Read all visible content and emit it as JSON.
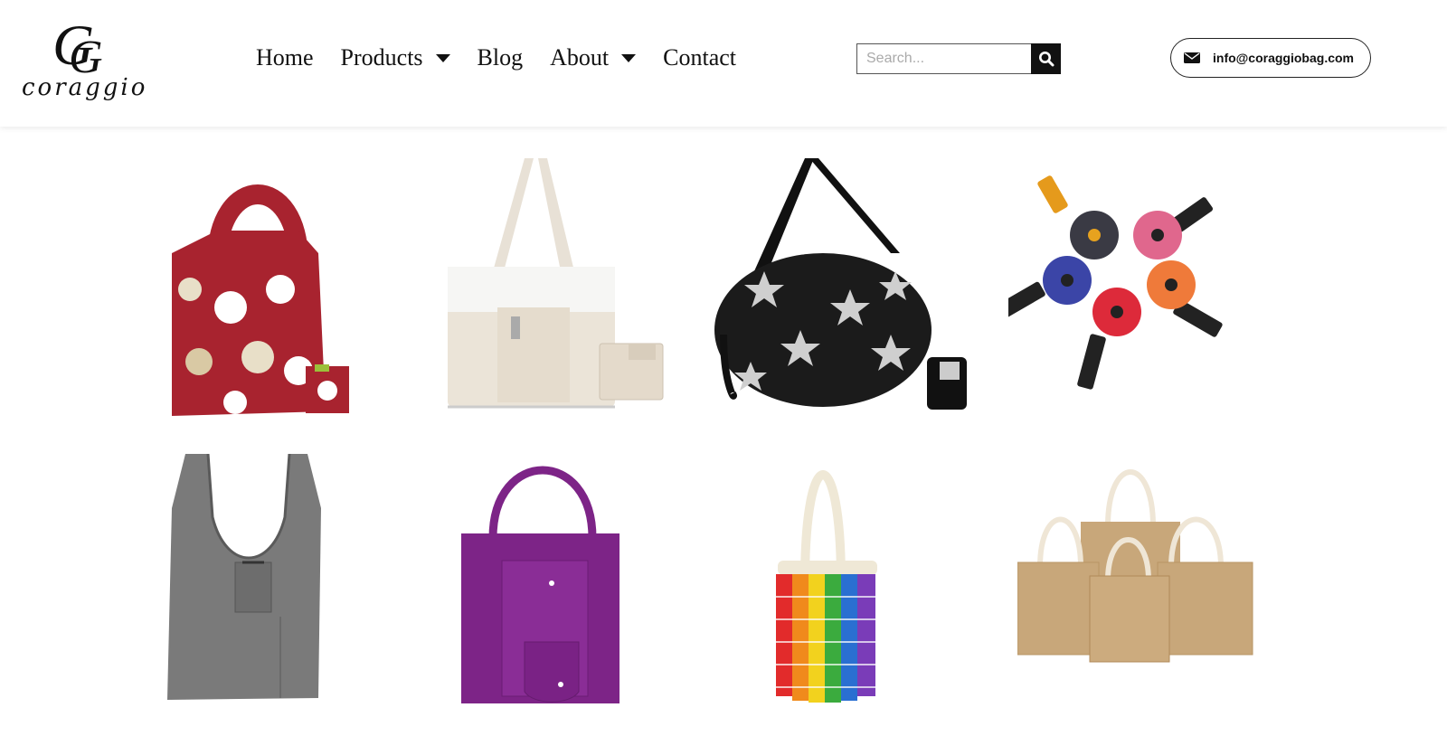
{
  "brand": {
    "logo_letters": "G",
    "logo_word": "coraggio"
  },
  "nav": {
    "items": [
      {
        "label": "Home",
        "has_dropdown": false
      },
      {
        "label": "Products",
        "has_dropdown": true
      },
      {
        "label": "Blog",
        "has_dropdown": false
      },
      {
        "label": "About",
        "has_dropdown": true
      },
      {
        "label": "Contact",
        "has_dropdown": false
      }
    ]
  },
  "search": {
    "placeholder": "Search...",
    "value": "",
    "icon": "search-icon"
  },
  "contact": {
    "email": "info@coraggiobag.com",
    "icon": "envelope-icon"
  },
  "colors": {
    "accent": "#111111",
    "background": "#ffffff"
  },
  "products": [
    {
      "id": "red-dog-print-tote",
      "color": "#a8232f"
    },
    {
      "id": "cream-canvas-tote",
      "color": "#ebe4d8"
    },
    {
      "id": "black-star-bag",
      "color": "#1b1b1b"
    },
    {
      "id": "round-pouch-set",
      "color": "#888888"
    },
    {
      "id": "grey-foldable-tote",
      "color": "#7a7a7a"
    },
    {
      "id": "purple-nonwoven-tote",
      "color": "#7d2487"
    },
    {
      "id": "rainbow-mesh-bag",
      "color": "#e04a2a"
    },
    {
      "id": "jute-tote-set",
      "color": "#c8a77a"
    }
  ]
}
